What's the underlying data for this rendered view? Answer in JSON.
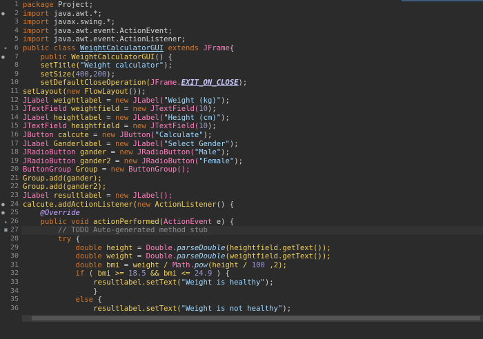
{
  "editor": {
    "line_numbers": [
      "1",
      "2",
      "3",
      "4",
      "5",
      "6",
      "7",
      "8",
      "9",
      "10",
      "11",
      "12",
      "13",
      "14",
      "15",
      "16",
      "17",
      "18",
      "19",
      "20",
      "21",
      "22",
      "23",
      "24",
      "25",
      "26",
      "27",
      "28",
      "29",
      "30",
      "31",
      "32",
      "33",
      "34",
      "35",
      "36"
    ],
    "tokens": {
      "l1": [
        "package",
        "Project;"
      ],
      "l2": [
        "import",
        "java.awt.*;"
      ],
      "l3": [
        "import",
        "javax.swing.*;"
      ],
      "l4": [
        "import",
        "java.awt.event.ActionEvent;"
      ],
      "l5": [
        "import",
        "java.awt.event.ActionListener;"
      ],
      "l6": [
        "public class",
        "WeightCalculatorGUI",
        "extends",
        "JFrame",
        "{"
      ],
      "l7": [
        "public",
        "WeightCalculatorGUI",
        "() {"
      ],
      "l8": [
        "setTitle(",
        "\"Weight calculator\"",
        ");"
      ],
      "l9": [
        "setSize(",
        "400",
        ",",
        "200",
        ");"
      ],
      "l10": [
        "setDefaultCloseOperation(",
        "JFrame.",
        "EXIT_ON_CLOSE",
        ");"
      ],
      "l11": [
        "setLayout(",
        "new",
        "FlowLayout",
        "());"
      ],
      "l12": [
        "JLabel",
        "weightlabel",
        "=",
        "new",
        "JLabel(",
        "\"Weight (kg)\"",
        ");"
      ],
      "l13": [
        "JTextField",
        "weightfield",
        "=",
        "new",
        "JTextField(",
        "10",
        ");"
      ],
      "l14": [
        "JLabel",
        "heightlabel",
        "=",
        "new",
        "JLabel(",
        "\"Height (cm)\"",
        ");"
      ],
      "l15": [
        "JTextField",
        "heightfield",
        "=",
        "new",
        "JTextField(",
        "10",
        ");"
      ],
      "l16": [
        "JButton",
        "calcute",
        "=",
        "new",
        "JButton(",
        "\"Calculate\"",
        ");"
      ],
      "l17": [
        "JLabel",
        "Ganderlabel",
        "=",
        "new",
        "JLabel(",
        "\"Select Gender\"",
        ");"
      ],
      "l18": [
        "JRadioButton",
        "gander",
        "=",
        "new",
        "JRadioButton(",
        "\"Male\"",
        ");"
      ],
      "l19": [
        "JRadioButton",
        "gander2",
        "=",
        "new",
        "JRadioButton(",
        "\"Female\"",
        ");"
      ],
      "l20": [
        "ButtonGroup",
        "Group",
        "=",
        "new",
        "ButtonGroup();"
      ],
      "l21": [
        "Group.add(gander);"
      ],
      "l22": [
        "Group.add(gander2);"
      ],
      "l23": [
        "JLabel",
        "resultlabel",
        "=",
        "new",
        "JLabel();"
      ],
      "l24": [
        "calcute.addActionListener(",
        "new",
        "ActionListener",
        "() {"
      ],
      "l25": [
        "@Override"
      ],
      "l26": [
        "public void",
        "actionPerformed(",
        "ActionEvent",
        "e) {"
      ],
      "l27": [
        "// TODO Auto-generated method stub"
      ],
      "l28": [
        "try",
        "{"
      ],
      "l29": [
        "double",
        "height",
        "=",
        "Double.",
        "parseDouble",
        "(heightfield.getText());"
      ],
      "l30": [
        "double",
        "weight",
        "=",
        "Double.",
        "parseDouble",
        "(weightfield.getText());"
      ],
      "l31": [
        "double",
        "bmi",
        "=",
        "weight /",
        "Math.",
        "pow",
        "(height /",
        "100",
        ",2);"
      ],
      "l32": [
        "if",
        "( bmi >=",
        "18.5",
        "&& bmi <=",
        "24.9",
        ") {"
      ],
      "l33": [
        "resultlabel.setText(",
        "\"Weight is healthy\"",
        ");"
      ],
      "l34": [
        "}"
      ],
      "l35": [
        "else",
        "{"
      ],
      "l36": [
        "resultlabel.setText(",
        "\"Weight is not healthy\"",
        ");"
      ]
    }
  }
}
